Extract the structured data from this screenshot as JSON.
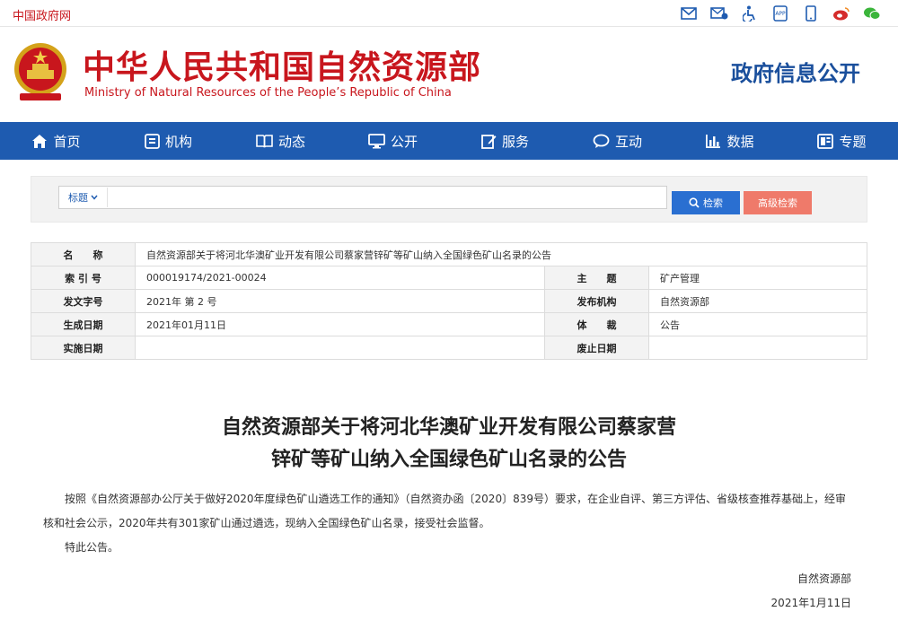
{
  "topbar": {
    "gov_link": "中国政府网",
    "icons": [
      "mail-icon",
      "contact-icon",
      "accessibility-icon",
      "app-icon",
      "mobile-icon",
      "weibo-icon",
      "wechat-icon"
    ]
  },
  "header": {
    "title_cn": "中华人民共和国自然资源部",
    "title_en": "Ministry of Natural Resources of the People’s Republic of China",
    "gov_info": "政府信息公开"
  },
  "nav": {
    "items": [
      {
        "label": "首页",
        "icon": "home-icon"
      },
      {
        "label": "机构",
        "icon": "org-icon"
      },
      {
        "label": "动态",
        "icon": "book-icon"
      },
      {
        "label": "公开",
        "icon": "monitor-icon"
      },
      {
        "label": "服务",
        "icon": "edit-icon"
      },
      {
        "label": "互动",
        "icon": "chat-icon"
      },
      {
        "label": "数据",
        "icon": "chart-icon"
      },
      {
        "label": "专题",
        "icon": "topic-icon"
      }
    ]
  },
  "search": {
    "type": "标题",
    "value": "",
    "search_button": "检索",
    "advanced_button": "高级检索"
  },
  "meta": {
    "name_label": "名　　称",
    "name_value": "自然资源部关于将河北华澳矿业开发有限公司蔡家营锌矿等矿山纳入全国绿色矿山名录的公告",
    "index_label": "索 引 号",
    "index_value": "000019174/2021-00024",
    "subject_label": "主　　题",
    "subject_value": "矿产管理",
    "docno_label": "发文字号",
    "docno_value": "2021年 第 2 号",
    "publisher_label": "发布机构",
    "publisher_value": "自然资源部",
    "created_label": "生成日期",
    "created_value": "2021年01月11日",
    "genre_label": "体　　裁",
    "genre_value": "公告",
    "effective_label": "实施日期",
    "effective_value": "",
    "expiry_label": "废止日期",
    "expiry_value": ""
  },
  "article": {
    "title_line1": "自然资源部关于将河北华澳矿业开发有限公司蔡家营",
    "title_line2": "锌矿等矿山纳入全国绿色矿山名录的公告",
    "paragraph1": "按照《自然资源部办公厅关于做好2020年度绿色矿山遴选工作的通知》（自然资办函〔2020〕839号）要求，在企业自评、第三方评估、省级核查推荐基础上，经审核和社会公示，2020年共有301家矿山通过遴选，现纳入全国绿色矿山名录，接受社会监督。",
    "paragraph2": "特此公告。",
    "signer": "自然资源部",
    "date": "2021年1月11日"
  }
}
